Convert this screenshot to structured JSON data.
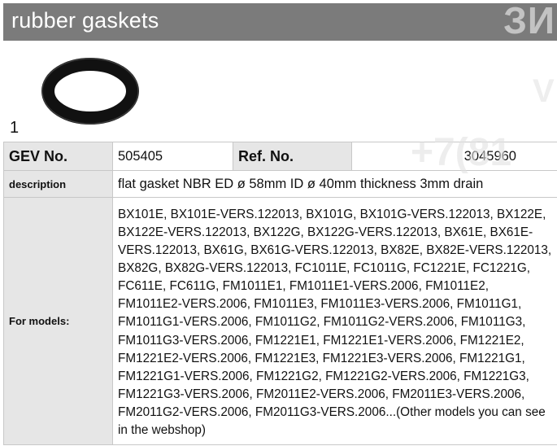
{
  "header": {
    "title": "rubber gaskets",
    "watermark": "ЗИ"
  },
  "image": {
    "number": "1",
    "icon": "gasket-ring-icon",
    "side_watermark": "V"
  },
  "watermark_phone": "+7(81",
  "table": {
    "gev_label": "GEV No.",
    "gev_value": "505405",
    "ref_label": "Ref. No.",
    "ref_value": "3045960",
    "description_label": "description",
    "description_value": "flat gasket  NBR ED ø 58mm ID ø 40mm thickness 3mm drain",
    "models_label": "For models:",
    "models_value": "BX101E, BX101E-VERS.122013, BX101G, BX101G-VERS.122013, BX122E, BX122E-VERS.122013, BX122G, BX122G-VERS.122013, BX61E, BX61E-VERS.122013, BX61G, BX61G-VERS.122013, BX82E, BX82E-VERS.122013, BX82G, BX82G-VERS.122013, FC1011E, FC1011G, FC1221E, FC1221G, FC611E, FC611G, FM1011E1, FM1011E1-VERS.2006, FM1011E2, FM1011E2-VERS.2006, FM1011E3, FM1011E3-VERS.2006, FM1011G1, FM1011G1-VERS.2006, FM1011G2, FM1011G2-VERS.2006, FM1011G3, FM1011G3-VERS.2006, FM1221E1, FM1221E1-VERS.2006, FM1221E2, FM1221E2-VERS.2006, FM1221E3, FM1221E3-VERS.2006, FM1221G1, FM1221G1-VERS.2006, FM1221G2, FM1221G2-VERS.2006, FM1221G3, FM1221G3-VERS.2006, FM2011E2-VERS.2006, FM2011E3-VERS.2006, FM2011G2-VERS.2006, FM2011G3-VERS.2006...(Other models you can see in the webshop)"
  }
}
